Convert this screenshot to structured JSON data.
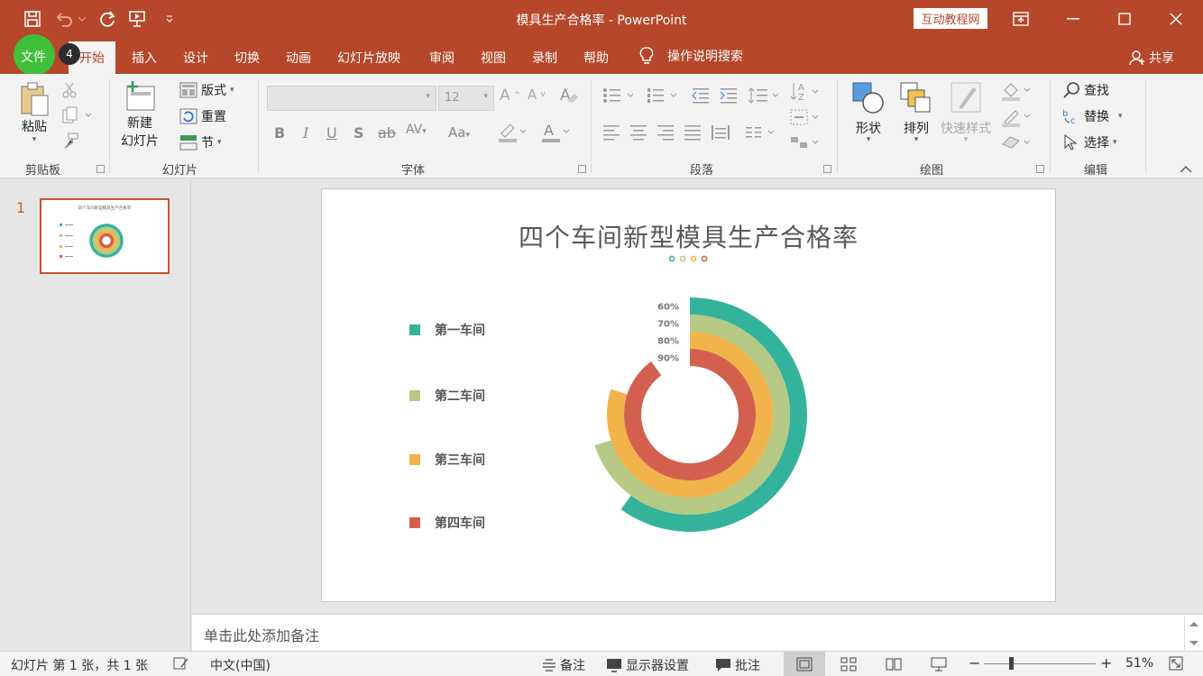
{
  "window": {
    "title": "模具生产合格率 - PowerPoint",
    "badge": "互动教程网"
  },
  "tabs": {
    "file": "文件",
    "key_hint": "4",
    "items": [
      "开始",
      "插入",
      "设计",
      "切换",
      "动画",
      "幻灯片放映",
      "审阅",
      "视图",
      "录制",
      "帮助"
    ],
    "search": "操作说明搜索",
    "share": "共享"
  },
  "ribbon": {
    "clipboard": {
      "paste": "粘贴",
      "label": "剪贴板"
    },
    "slides": {
      "new_line1": "新建",
      "new_line2": "幻灯片",
      "layout": "版式",
      "reset": "重置",
      "section": "节",
      "label": "幻灯片"
    },
    "font": {
      "font_size": "12",
      "label": "字体"
    },
    "paragraph": {
      "label": "段落"
    },
    "drawing": {
      "shapes": "形状",
      "arrange": "排列",
      "quick_styles": "快速样式",
      "label": "绘图"
    },
    "editing": {
      "find": "查找",
      "replace": "替换",
      "select": "选择",
      "label": "编辑"
    }
  },
  "slide_panel": {
    "slide_number": "1",
    "thumb_title": "四个车间新型模具生产合格率"
  },
  "slide": {
    "title": "四个车间新型模具生产合格率",
    "dots": [
      "#3aab9a",
      "#b5c77f",
      "#f0b54a",
      "#cf5a4b"
    ]
  },
  "chart_data": {
    "type": "radial-bar",
    "title": "四个车间新型模具生产合格率",
    "categories": [
      "第一车间",
      "第二车间",
      "第三车间",
      "第四车间"
    ],
    "values": [
      0.6,
      0.7,
      0.8,
      0.9
    ],
    "labels": [
      "60%",
      "70%",
      "80%",
      "90%"
    ],
    "colors": [
      "#34b39c",
      "#b6c985",
      "#f2b44a",
      "#d3604f"
    ],
    "legend": "left"
  },
  "notes": {
    "placeholder": "单击此处添加备注"
  },
  "status": {
    "slide_info": "幻灯片 第 1 张，共 1 张",
    "language": "中文(中国)",
    "notes": "备注",
    "display": "显示器设置",
    "comments": "批注",
    "zoom": "51%"
  }
}
